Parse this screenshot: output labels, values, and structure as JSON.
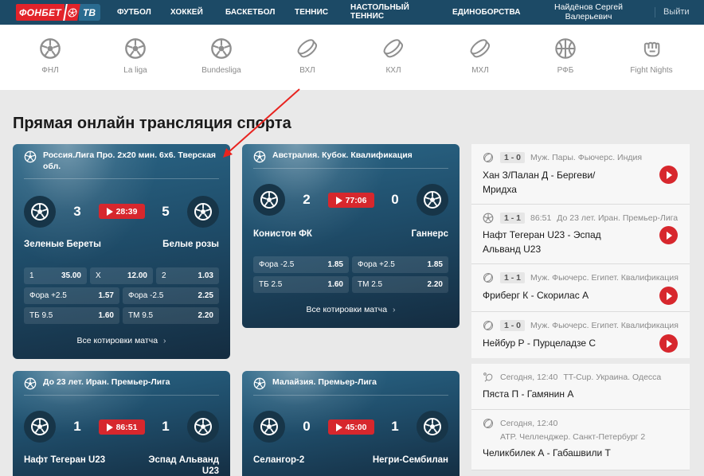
{
  "header": {
    "logo": {
      "brand": "ФОНБЕТ",
      "suffix": "ТВ"
    },
    "nav": [
      "ФУТБОЛ",
      "ХОККЕЙ",
      "БАСКЕТБОЛ",
      "ТЕННИС",
      "НАСТОЛЬНЫЙ ТЕННИС",
      "ЕДИНОБОРСТВА"
    ],
    "user_name": "Найдёнов Сергей Валерьевич",
    "logout": "Выйти"
  },
  "leagues": [
    {
      "label": "ФНЛ",
      "icon": "soccer-ball-icon"
    },
    {
      "label": "La liga",
      "icon": "soccer-ball-icon"
    },
    {
      "label": "Bundesliga",
      "icon": "soccer-ball-icon"
    },
    {
      "label": "ВХЛ",
      "icon": "hockey-puck-icon"
    },
    {
      "label": "КХЛ",
      "icon": "hockey-puck-icon"
    },
    {
      "label": "МХЛ",
      "icon": "hockey-puck-icon"
    },
    {
      "label": "РФБ",
      "icon": "basketball-icon"
    },
    {
      "label": "Fight Nights",
      "icon": "fist-icon"
    }
  ],
  "page_title": "Прямая онлайн трансляция спорта",
  "cards": [
    {
      "league": "Россия.Лига Про. 2х20 мин. 6х6. Тверская обл.",
      "home": "Зеленые Береты",
      "away": "Белые розы",
      "home_score": "3",
      "away_score": "5",
      "time": "28:39",
      "odds": [
        [
          {
            "k": "1",
            "v": "35.00"
          },
          {
            "k": "X",
            "v": "12.00"
          },
          {
            "k": "2",
            "v": "1.03"
          }
        ],
        [
          {
            "k": "Фора +2.5",
            "v": "1.57"
          },
          {
            "k": "Фора -2.5",
            "v": "2.25"
          }
        ],
        [
          {
            "k": "ТБ 9.5",
            "v": "1.60"
          },
          {
            "k": "ТМ 9.5",
            "v": "2.20"
          }
        ]
      ],
      "all_odds": "Все котировки матча"
    },
    {
      "league": "Австралия. Кубок. Квалификация",
      "home": "Конистон ФК",
      "away": "Ганнерс",
      "home_score": "2",
      "away_score": "0",
      "time": "77:06",
      "odds": [
        [
          {
            "k": "Фора -2.5",
            "v": "1.85"
          },
          {
            "k": "Фора +2.5",
            "v": "1.85"
          }
        ],
        [
          {
            "k": "ТБ 2.5",
            "v": "1.60"
          },
          {
            "k": "ТМ 2.5",
            "v": "2.20"
          }
        ]
      ],
      "all_odds": "Все котировки матча"
    },
    {
      "league": "До 23 лет. Иран. Премьер-Лига",
      "home": "Нафт Тегеран U23",
      "away": "Эспад Альванд U23",
      "home_score": "1",
      "away_score": "1",
      "time": "86:51"
    },
    {
      "league": "Малайзия. Премьер-Лига",
      "home": "Селангор-2",
      "away": "Негри-Сембилан",
      "home_score": "0",
      "away_score": "1",
      "time": "45:00"
    }
  ],
  "sidebar": [
    {
      "sport": "tennis",
      "score": "1 - 0",
      "time": "",
      "league": "Муж. Пары. Фьючерс. Индия",
      "name": "Хан З/Палан Д - Бергеви/ Мридха",
      "live": true
    },
    {
      "sport": "soccer",
      "score": "1 - 1",
      "time": "86:51",
      "league": "До 23 лет. Иран. Премьер-Лига",
      "name": "Нафт Тегеран U23 - Эспад Альванд U23",
      "live": true
    },
    {
      "sport": "tennis",
      "score": "1 - 1",
      "time": "",
      "league": "Муж. Фьючерс. Египет. Квалификация",
      "name": "Фриберг К - Скорилас А",
      "live": true
    },
    {
      "sport": "tennis",
      "score": "1 - 0",
      "time": "",
      "league": "Муж. Фьючерс. Египет. Квалификация",
      "name": "Нейбур Р - Пурцеладзе С",
      "live": true
    },
    {
      "sport": "table-tennis",
      "score": "",
      "time": "Сегодня, 12:40",
      "league": "TT-Cup. Украина. Одесса",
      "name": "Пяста П - Гамянин А",
      "live": false
    },
    {
      "sport": "tennis",
      "score": "",
      "time": "Сегодня, 12:40",
      "league": "ATP. Челленджер. Санкт-Петербург 2",
      "name": "Челикбилек А - Габашвили Т",
      "live": false
    }
  ]
}
